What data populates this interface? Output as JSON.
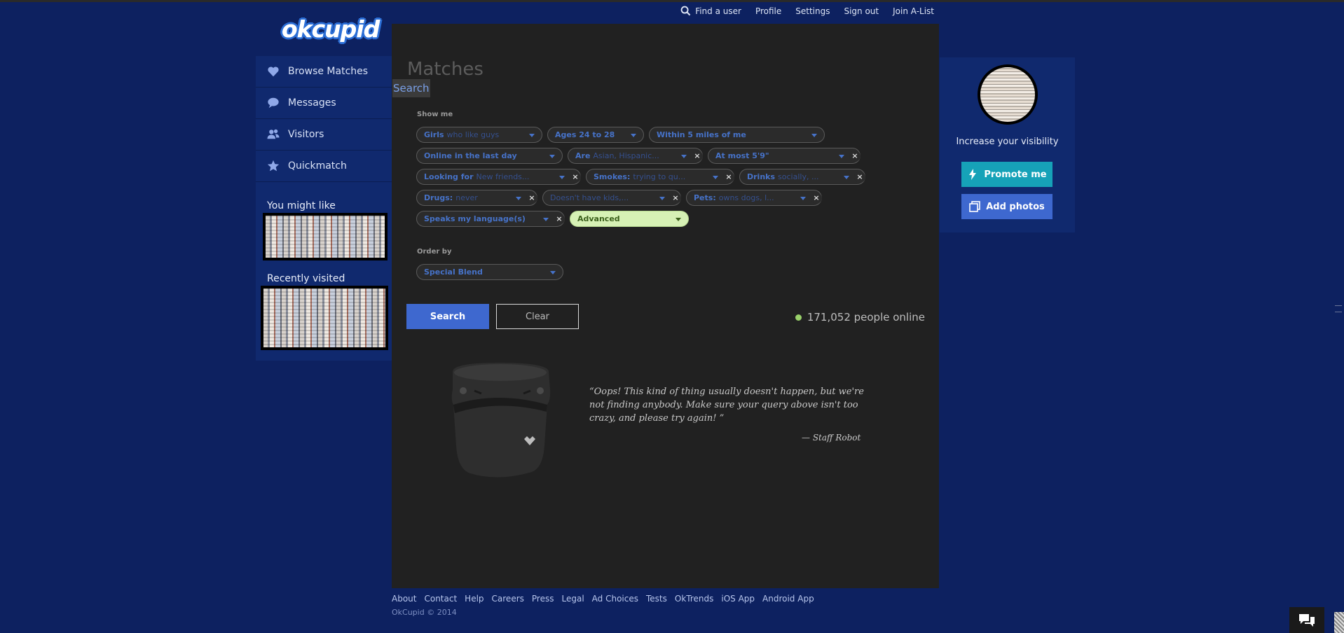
{
  "topnav": {
    "find_user": "Find a user",
    "profile": "Profile",
    "settings": "Settings",
    "sign_out": "Sign out",
    "join_alist": "Join A-List"
  },
  "logo_text": "okcupid",
  "sidebar": {
    "items": [
      {
        "label": "Browse Matches",
        "icon": "heart-icon"
      },
      {
        "label": "Messages",
        "icon": "speech-bubble-icon"
      },
      {
        "label": "Visitors",
        "icon": "people-icon"
      },
      {
        "label": "Quickmatch",
        "icon": "star-icon"
      }
    ],
    "you_might_like": "You might like",
    "recently_visited": "Recently visited"
  },
  "main": {
    "title": "Matches",
    "search_tab": "Search",
    "show_me_label": "Show me",
    "order_by_label": "Order by",
    "filters": [
      [
        {
          "bold": "Girls",
          "value": "who like guys",
          "removable": false
        },
        {
          "bold": "Ages 24 to 28",
          "value": "",
          "removable": false
        },
        {
          "bold": "Within 5 miles of me",
          "value": "",
          "removable": false
        }
      ],
      [
        {
          "bold": "Online in the last day",
          "value": "",
          "removable": false
        },
        {
          "bold": "Are",
          "value": "Asian, Hispanic...",
          "removable": true
        },
        {
          "bold": "At most 5'9\"",
          "value": "",
          "removable": true
        }
      ],
      [
        {
          "bold": "Looking for",
          "value": "New friends...",
          "removable": true
        },
        {
          "bold": "Smokes:",
          "value": "trying to qu...",
          "removable": true
        },
        {
          "bold": "Drinks",
          "value": "socially, ...",
          "removable": true
        }
      ],
      [
        {
          "bold": "Drugs:",
          "value": "never",
          "removable": true
        },
        {
          "bold": "",
          "value": "Doesn't have kids,...",
          "removable": true
        },
        {
          "bold": "Pets:",
          "value": "owns dogs, l...",
          "removable": true
        }
      ],
      [
        {
          "bold": "Speaks my language(s)",
          "value": "",
          "removable": true
        },
        {
          "bold": "Advanced",
          "value": "",
          "removable": false,
          "advanced": true
        }
      ]
    ],
    "order_by_value": "Special Blend",
    "search_button": "Search",
    "clear_button": "Clear",
    "online_count": "171,052 people online",
    "online_color": "#99d16a",
    "quote": "“Oops! This kind of thing usually doesn't happen, but we're not finding anybody. Make sure your query above isn't too crazy, and please try again! ”",
    "quote_author": "— Staff Robot"
  },
  "right_card": {
    "visibility_text": "Increase your visibility",
    "promote_button": "Promote me",
    "add_photos_button": "Add photos",
    "promote_color": "#16a2b8",
    "photos_color": "#3e68cf"
  },
  "footer": {
    "links": [
      "About",
      "Contact",
      "Help",
      "Careers",
      "Press",
      "Legal",
      "Ad Choices",
      "Tests",
      "OkTrends",
      "iOS App",
      "Android App"
    ],
    "copyright": "OkCupid © 2014"
  },
  "colors": {
    "background": "#0d2160",
    "panel": "#212121",
    "sidebar": "#10296e",
    "accent": "#3e68cf"
  }
}
